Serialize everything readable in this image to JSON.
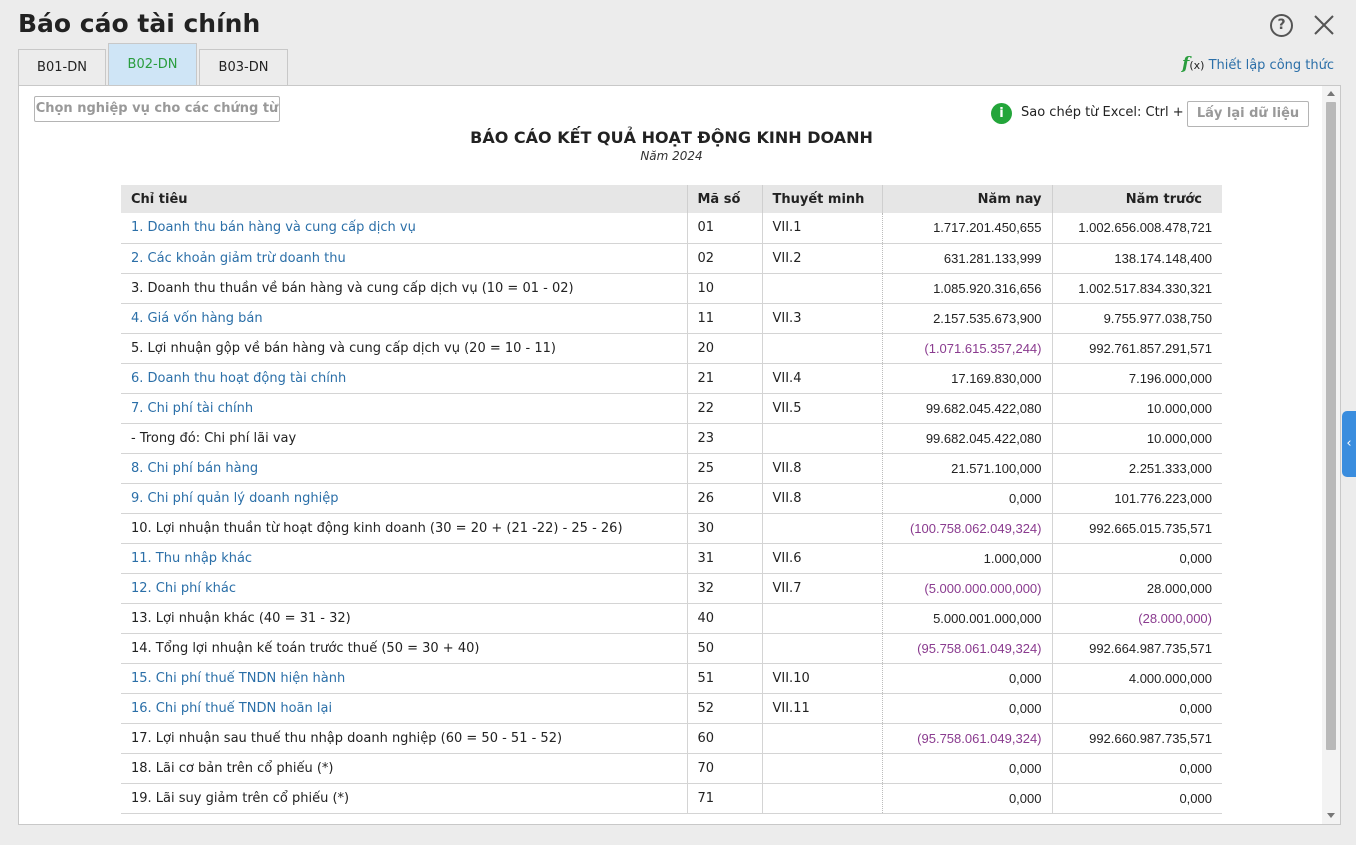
{
  "window": {
    "title": "Báo cáo tài chính",
    "help_glyph": "?",
    "help_icon": "question-circle-icon",
    "close_icon": "close-x-icon"
  },
  "tabs": [
    {
      "label": "B01-DN",
      "active": false
    },
    {
      "label": "B02-DN",
      "active": true
    },
    {
      "label": "B03-DN",
      "active": false
    }
  ],
  "formula": {
    "icon_glyph": "f",
    "icon_paren": "(x)",
    "label": "Thiết lập công thức"
  },
  "toolbar": {
    "select_voucher_button": "Chọn nghiệp vụ cho các chứng từ",
    "info_glyph": "i",
    "copy_excel_hint": "Sao chép từ Excel: Ctrl + V",
    "reload_button": "Lấy lại dữ liệu"
  },
  "report": {
    "title": "BÁO CÁO KẾT QUẢ HOẠT ĐỘNG KINH DOANH",
    "subtitle": "Năm 2024",
    "columns": [
      "Chỉ tiêu",
      "Mã số",
      "Thuyết minh",
      "Năm nay",
      "Năm trước"
    ],
    "rows": [
      {
        "name": "1. Doanh thu bán hàng và cung cấp dịch vụ",
        "code": "01",
        "note": "VII.1",
        "current": "1.717.201.450,655",
        "previous": "1.002.656.008.478,721",
        "link": true
      },
      {
        "name": "2. Các khoản giảm trừ doanh thu",
        "code": "02",
        "note": "VII.2",
        "current": "631.281.133,999",
        "previous": "138.174.148,400",
        "link": true
      },
      {
        "name": "3. Doanh thu thuần về bán hàng và cung cấp dịch vụ (10 = 01 - 02)",
        "code": "10",
        "note": "",
        "current": "1.085.920.316,656",
        "previous": "1.002.517.834.330,321",
        "link": false
      },
      {
        "name": "4. Giá vốn hàng bán",
        "code": "11",
        "note": "VII.3",
        "current": "2.157.535.673,900",
        "previous": "9.755.977.038,750",
        "link": true
      },
      {
        "name": "5. Lợi nhuận gộp về bán hàng và cung cấp dịch vụ (20 = 10 - 11)",
        "code": "20",
        "note": "",
        "current": "(1.071.615.357,244)",
        "previous": "992.761.857.291,571",
        "link": false
      },
      {
        "name": "6. Doanh thu hoạt động tài chính",
        "code": "21",
        "note": "VII.4",
        "current": "17.169.830,000",
        "previous": "7.196.000,000",
        "link": true
      },
      {
        "name": "7. Chi phí tài chính",
        "code": "22",
        "note": "VII.5",
        "current": "99.682.045.422,080",
        "previous": "10.000,000",
        "link": true
      },
      {
        "name": "- Trong đó: Chi phí lãi vay",
        "code": "23",
        "note": "",
        "current": "99.682.045.422,080",
        "previous": "10.000,000",
        "link": false
      },
      {
        "name": "8. Chi phí bán hàng",
        "code": "25",
        "note": "VII.8",
        "current": "21.571.100,000",
        "previous": "2.251.333,000",
        "link": true
      },
      {
        "name": "9. Chi phí quản lý doanh nghiệp",
        "code": "26",
        "note": "VII.8",
        "current": "0,000",
        "previous": "101.776.223,000",
        "link": true
      },
      {
        "name": "10. Lợi nhuận thuần từ hoạt động kinh doanh (30 = 20 + (21 -22) - 25 - 26)",
        "code": "30",
        "note": "",
        "current": "(100.758.062.049,324)",
        "previous": "992.665.015.735,571",
        "link": false
      },
      {
        "name": "11. Thu nhập khác",
        "code": "31",
        "note": "VII.6",
        "current": "1.000,000",
        "previous": "0,000",
        "link": true
      },
      {
        "name": "12. Chi phí khác",
        "code": "32",
        "note": "VII.7",
        "current": "(5.000.000.000,000)",
        "previous": "28.000,000",
        "link": true
      },
      {
        "name": "13. Lợi nhuận khác (40 = 31 - 32)",
        "code": "40",
        "note": "",
        "current": "5.000.001.000,000",
        "previous": "(28.000,000)",
        "link": false
      },
      {
        "name": "14. Tổng lợi nhuận kế toán trước thuế (50 = 30 + 40)",
        "code": "50",
        "note": "",
        "current": "(95.758.061.049,324)",
        "previous": "992.664.987.735,571",
        "link": false
      },
      {
        "name": "15. Chi phí thuế TNDN hiện hành",
        "code": "51",
        "note": "VII.10",
        "current": "0,000",
        "previous": "4.000.000,000",
        "link": true
      },
      {
        "name": "16. Chi phí thuế TNDN hoãn lại",
        "code": "52",
        "note": "VII.11",
        "current": "0,000",
        "previous": "0,000",
        "link": true
      },
      {
        "name": "17. Lợi nhuận sau thuế thu nhập doanh nghiệp (60 = 50 - 51 - 52)",
        "code": "60",
        "note": "",
        "current": "(95.758.061.049,324)",
        "previous": "992.660.987.735,571",
        "link": false
      },
      {
        "name": "18. Lãi cơ bản trên cổ phiếu (*)",
        "code": "70",
        "note": "",
        "current": "0,000",
        "previous": "0,000",
        "link": false
      },
      {
        "name": "19. Lãi suy giảm trên cổ phiếu (*)",
        "code": "71",
        "note": "",
        "current": "0,000",
        "previous": "0,000",
        "link": false
      }
    ]
  },
  "side_panel": {
    "glyph": "‹",
    "icon": "chevron-left-icon"
  },
  "colors": {
    "link": "#2b6fa8",
    "negative": "#8a3b8f",
    "active_tab_bg": "#cfe5f6",
    "active_tab_text": "#2a9d3e",
    "info_green": "#23a53a",
    "side_tab": "#3a8dde"
  }
}
